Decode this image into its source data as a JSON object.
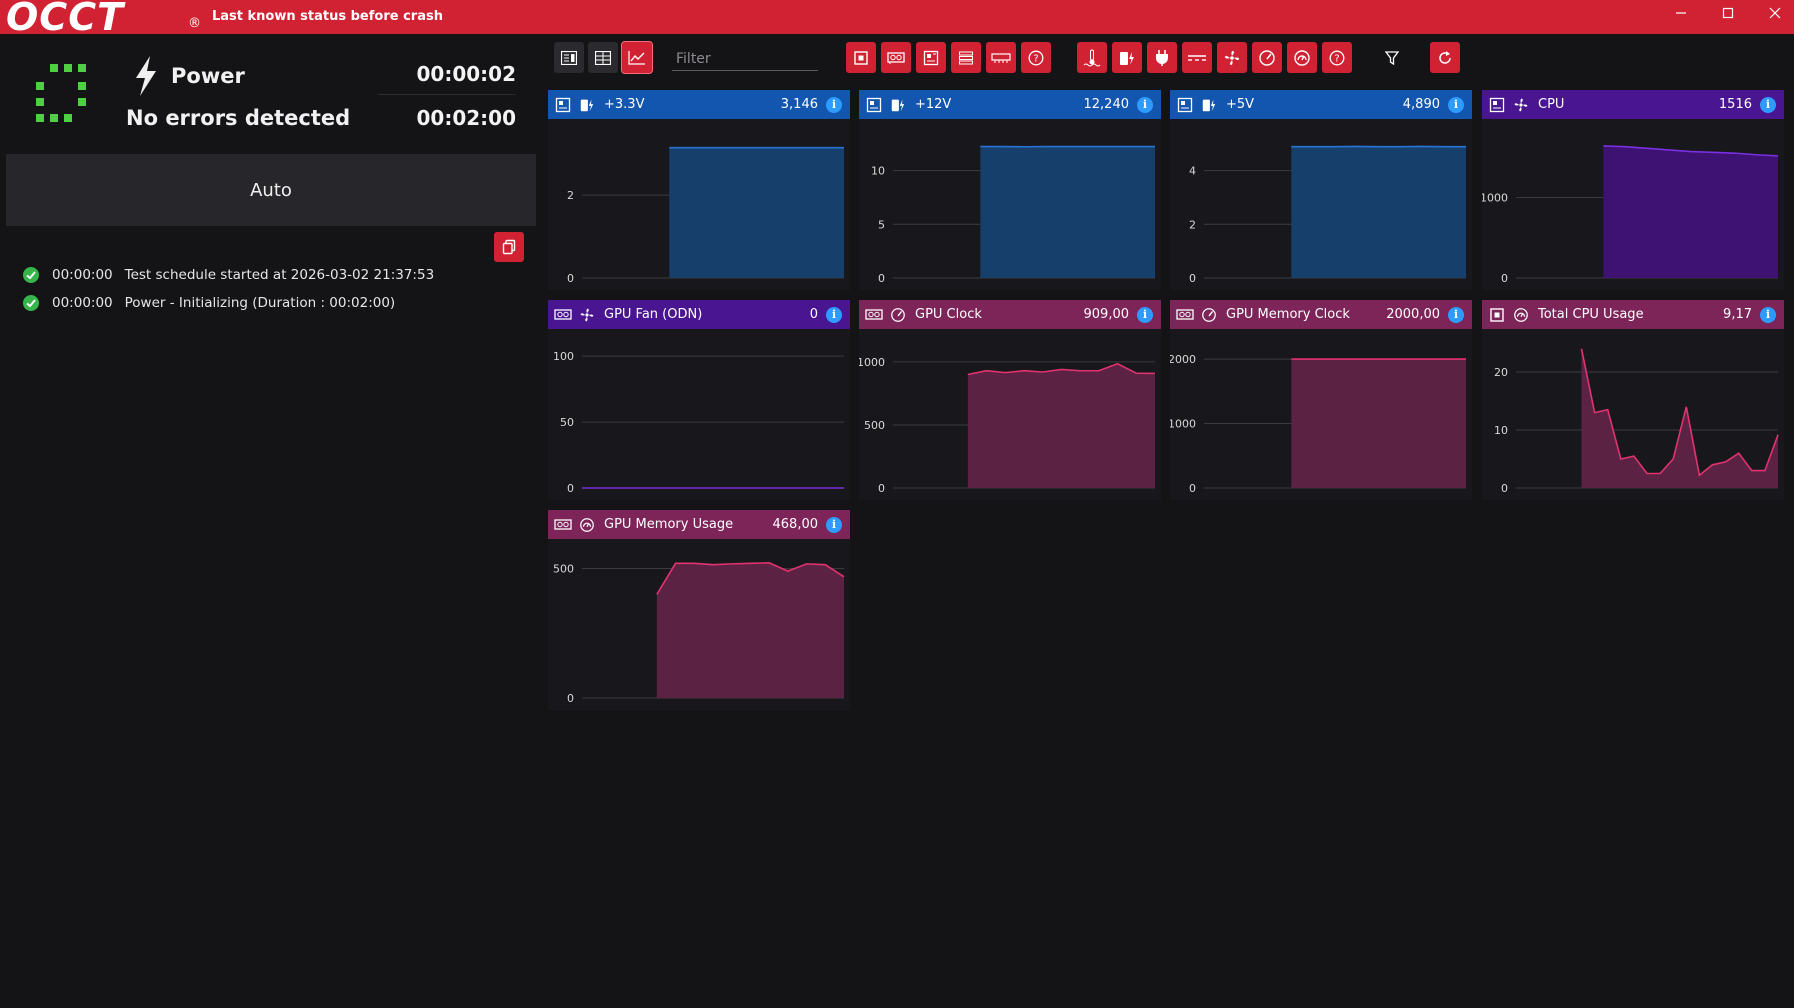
{
  "titlebar": {
    "logo": "OCCT",
    "registered": "®",
    "status": "Last known status before crash"
  },
  "test": {
    "name": "Power",
    "status": "No errors detected",
    "elapsed": "00:00:02",
    "duration": "00:02:00",
    "mode": "Auto"
  },
  "log": [
    {
      "time": "00:00:00",
      "message": "Test schedule started at 2026-03-02 21:37:53"
    },
    {
      "time": "00:00:00",
      "message": "Power - Initializing (Duration : 00:02:00)"
    }
  ],
  "toolbar": {
    "filter_placeholder": "Filter"
  },
  "colors": {
    "titlebar": "#d12233",
    "blue_header": "#1356b0",
    "purple_header": "#4a1591",
    "magenta_header": "#7d2459",
    "blue_fill": "#163f6b",
    "purple_fill": "#3d1272",
    "magenta_fill": "#5b2243"
  },
  "chart_data": [
    {
      "type": "area",
      "title": "+3.3V",
      "value_label": "3,146",
      "ylim": [
        0,
        3.5
      ],
      "yticks": [
        "0",
        "2"
      ],
      "yticks_values": [
        0,
        2
      ],
      "theme": "blue",
      "x": [
        0,
        1,
        2,
        3,
        4,
        5,
        6,
        7,
        8,
        9,
        10,
        11,
        12
      ],
      "values": [
        null,
        null,
        null,
        null,
        3.146,
        3.146,
        3.146,
        3.146,
        3.146,
        3.146,
        3.146,
        3.146,
        3.146
      ]
    },
    {
      "type": "area",
      "title": "+12V",
      "value_label": "12,240",
      "ylim": [
        0,
        13.5
      ],
      "yticks": [
        "0",
        "5",
        "10"
      ],
      "yticks_values": [
        0,
        5,
        10
      ],
      "theme": "blue",
      "x": [
        0,
        1,
        2,
        3,
        4,
        5,
        6,
        7,
        8,
        9,
        10,
        11,
        12
      ],
      "values": [
        null,
        null,
        null,
        null,
        12.24,
        12.24,
        12.22,
        12.24,
        12.24,
        12.24,
        12.24,
        12.24,
        12.24
      ]
    },
    {
      "type": "area",
      "title": "+5V",
      "value_label": "4,890",
      "ylim": [
        0,
        5.4
      ],
      "yticks": [
        "0",
        "2",
        "4"
      ],
      "yticks_values": [
        0,
        2,
        4
      ],
      "theme": "blue",
      "x": [
        0,
        1,
        2,
        3,
        4,
        5,
        6,
        7,
        8,
        9,
        10,
        11,
        12
      ],
      "values": [
        null,
        null,
        null,
        null,
        4.89,
        4.89,
        4.89,
        4.9,
        4.89,
        4.89,
        4.9,
        4.89,
        4.89
      ]
    },
    {
      "type": "area",
      "title": "CPU",
      "value_label": "1516",
      "ylim": [
        0,
        1800
      ],
      "yticks": [
        "0",
        "1000"
      ],
      "yticks_values": [
        0,
        1000
      ],
      "theme": "purple",
      "x": [
        0,
        1,
        2,
        3,
        4,
        5,
        6,
        7,
        8,
        9,
        10,
        11,
        12
      ],
      "values": [
        null,
        null,
        null,
        null,
        1640,
        1630,
        1610,
        1590,
        1570,
        1560,
        1550,
        1530,
        1516
      ]
    },
    {
      "type": "area",
      "title": "GPU Fan (ODN)",
      "value_label": "0",
      "ylim": [
        0,
        110
      ],
      "yticks": [
        "0",
        "50",
        "100"
      ],
      "yticks_values": [
        0,
        50,
        100
      ],
      "theme": "purple",
      "x": [
        0,
        1,
        2,
        3,
        4,
        5,
        6,
        7,
        8,
        9,
        10,
        11,
        12
      ],
      "values": [
        0,
        0,
        0,
        0,
        0,
        0,
        0,
        0,
        0,
        0,
        0,
        0,
        0
      ]
    },
    {
      "type": "area",
      "title": "GPU Clock",
      "value_label": "909,00",
      "ylim": [
        0,
        1150
      ],
      "yticks": [
        "0",
        "500",
        "1000"
      ],
      "yticks_values": [
        0,
        500,
        1000
      ],
      "theme": "magenta",
      "x": [
        0,
        1,
        2,
        3,
        4,
        5,
        6,
        7,
        8,
        9,
        10,
        11,
        12,
        13,
        14
      ],
      "values": [
        null,
        null,
        null,
        null,
        900,
        930,
        915,
        930,
        920,
        940,
        930,
        930,
        985,
        910,
        909
      ]
    },
    {
      "type": "area",
      "title": "GPU Memory Clock",
      "value_label": "2000,00",
      "ylim": [
        0,
        2250
      ],
      "yticks": [
        "0",
        "1000",
        "2000"
      ],
      "yticks_values": [
        0,
        1000,
        2000
      ],
      "theme": "magenta",
      "x": [
        0,
        1,
        2,
        3,
        4,
        5,
        6,
        7,
        8,
        9,
        10,
        11,
        12
      ],
      "values": [
        null,
        null,
        null,
        null,
        2000,
        2000,
        2000,
        2000,
        2000,
        2000,
        2000,
        2000,
        2000
      ]
    },
    {
      "type": "area",
      "title": "Total CPU Usage",
      "value_label": "9,17",
      "ylim": [
        0,
        25
      ],
      "yticks": [
        "0",
        "10",
        "20"
      ],
      "yticks_values": [
        0,
        10,
        20
      ],
      "theme": "magenta",
      "x": [
        0,
        1,
        2,
        3,
        4,
        5,
        6,
        7,
        8,
        9,
        10,
        11,
        12,
        13,
        14,
        15,
        16,
        17,
        18,
        19,
        20
      ],
      "values": [
        null,
        null,
        null,
        null,
        null,
        24,
        13,
        13.5,
        5,
        5.5,
        2.5,
        2.5,
        5,
        14,
        2.2,
        4,
        4.5,
        6,
        3,
        3,
        9.17
      ]
    },
    {
      "type": "area",
      "title": "GPU Memory Usage",
      "value_label": "468,00",
      "ylim": [
        0,
        560
      ],
      "yticks": [
        "0",
        "500"
      ],
      "yticks_values": [
        0,
        500
      ],
      "theme": "magenta",
      "x": [
        0,
        1,
        2,
        3,
        4,
        5,
        6,
        7,
        8,
        9,
        10,
        11,
        12,
        13,
        14
      ],
      "values": [
        null,
        null,
        null,
        null,
        400,
        520,
        520,
        515,
        518,
        520,
        522,
        490,
        518,
        515,
        468
      ]
    }
  ]
}
